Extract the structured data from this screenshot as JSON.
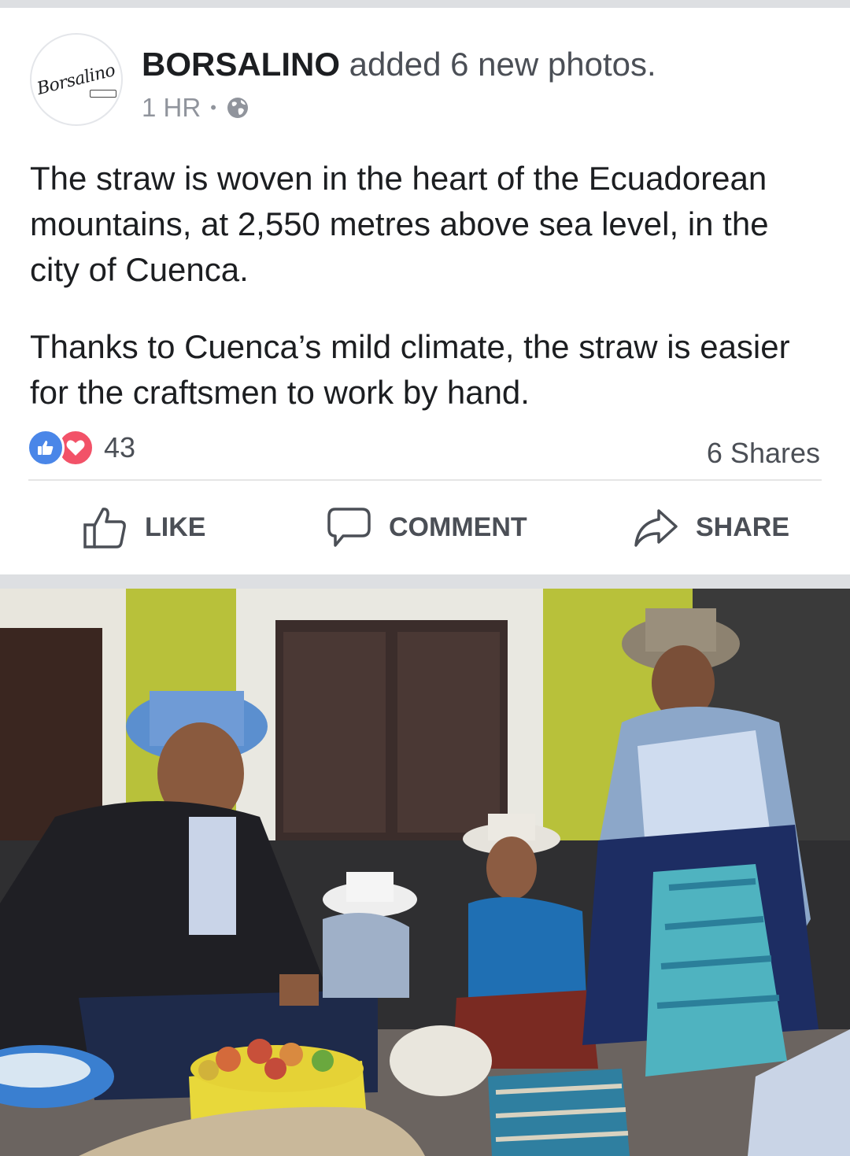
{
  "post": {
    "page_name": "BORSALINO",
    "action_text": " added 6 new photos.",
    "avatar_logo": "Borsalino",
    "time": "1 HR",
    "visibility_icon": "globe-icon",
    "paragraphs": [
      "The straw is woven in the heart of the Ecuadorean mountains, at 2,550 metres above sea level, in the city of Cuenca.",
      "Thanks to Cuenca’s mild climate, the straw is easier for the craftsmen to work by hand."
    ]
  },
  "engagement": {
    "reaction_icons": [
      "like-icon",
      "love-icon"
    ],
    "reaction_count": "43",
    "shares": "6 Shares"
  },
  "actions": {
    "like": "LIKE",
    "comment": "COMMENT",
    "share": "SHARE"
  },
  "colors": {
    "like_blue": "#4a86e8",
    "love_red": "#f25268",
    "text": "#1c1e21",
    "secondary_text": "#4b4f56",
    "meta_text": "#90949c",
    "background": "#dddfe2"
  }
}
